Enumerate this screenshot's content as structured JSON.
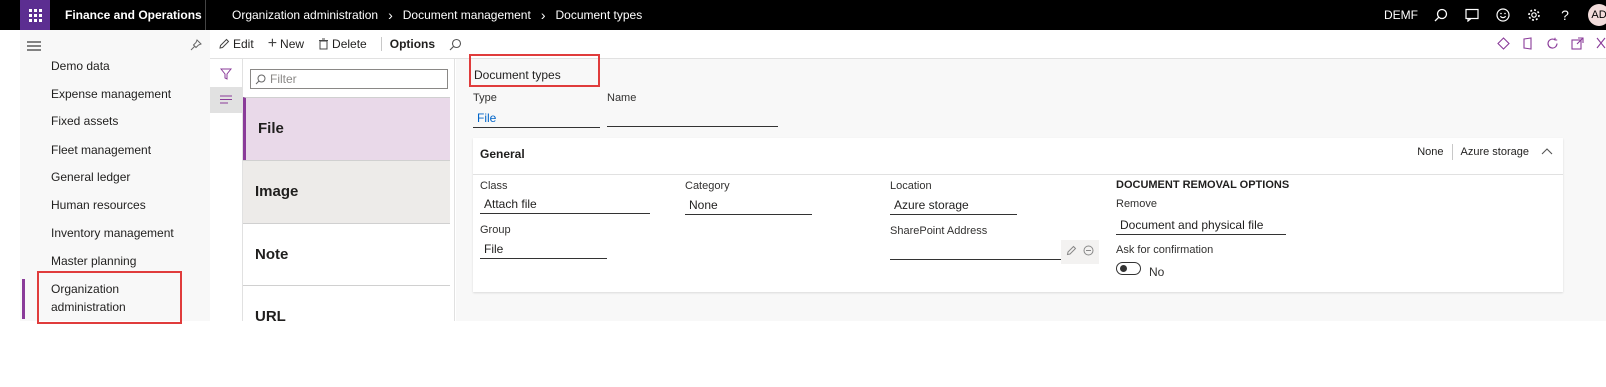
{
  "app": {
    "title": "Finance and Operations",
    "company": "DEMF",
    "avatar_initials": "AD"
  },
  "breadcrumb": [
    "Organization administration",
    "Document management",
    "Document types"
  ],
  "nav": {
    "items": [
      "Demo data",
      "Expense management",
      "Fixed assets",
      "Fleet management",
      "General ledger",
      "Human resources",
      "Inventory management",
      "Master planning"
    ],
    "active_line1": "Organization",
    "active_line2": "administration"
  },
  "command_bar": {
    "edit": "Edit",
    "new": "New",
    "delete": "Delete",
    "options": "Options"
  },
  "filter": {
    "placeholder": "Filter"
  },
  "list": [
    "File",
    "Image",
    "Note",
    "URL"
  ],
  "detail": {
    "page_title": "Document types",
    "type_label": "Type",
    "type_value": "File",
    "name_label": "Name",
    "name_value": "",
    "general": {
      "title": "General",
      "summary_1": "None",
      "summary_2": "Azure storage",
      "class_label": "Class",
      "class_value": "Attach file",
      "group_label": "Group",
      "group_value": "File",
      "category_label": "Category",
      "category_value": "None",
      "location_label": "Location",
      "location_value": "Azure storage",
      "sharepoint_label": "SharePoint Address",
      "sharepoint_value": "",
      "removal_heading": "DOCUMENT REMOVAL OPTIONS",
      "remove_label": "Remove",
      "remove_value": "Document and physical file",
      "confirm_label": "Ask for confirmation",
      "confirm_value": "No"
    }
  },
  "colors": {
    "accent": "#8a3b99",
    "waffle": "#5c2e91",
    "highlight": "#e03c3c",
    "link": "#0064c8"
  }
}
